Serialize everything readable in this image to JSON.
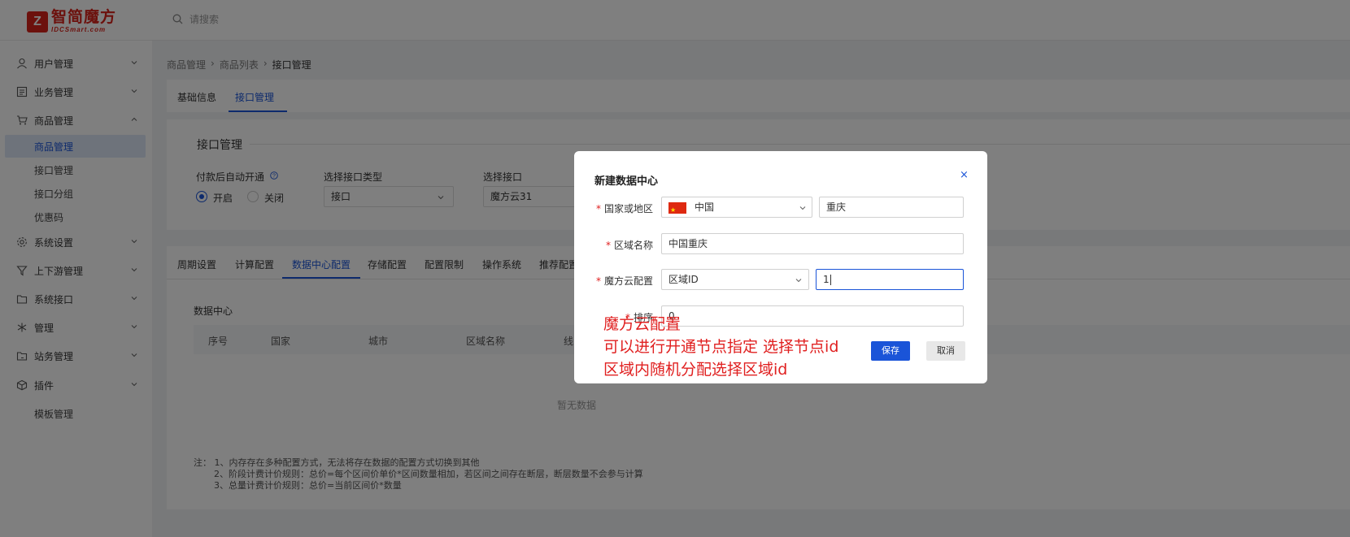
{
  "header": {
    "logo_cn": "智简魔方",
    "logo_en": "IDCSmart.com",
    "search_placeholder": "请搜索"
  },
  "sidebar": {
    "items": [
      {
        "label": "用户管理",
        "icon": "user-icon"
      },
      {
        "label": "业务管理",
        "icon": "list-icon"
      },
      {
        "label": "商品管理",
        "icon": "cart-icon",
        "expanded": true
      },
      {
        "label": "系统设置",
        "icon": "gear-icon"
      },
      {
        "label": "上下游管理",
        "icon": "filter-icon"
      },
      {
        "label": "系统接口",
        "icon": "folder-icon"
      },
      {
        "label": "管理",
        "icon": "asterisk-icon"
      },
      {
        "label": "站务管理",
        "icon": "folder-edit-icon"
      },
      {
        "label": "插件",
        "icon": "box-icon"
      }
    ],
    "subitems": [
      {
        "label": "商品管理",
        "active": true
      },
      {
        "label": "接口管理"
      },
      {
        "label": "接口分组"
      },
      {
        "label": "优惠码"
      }
    ],
    "template_item": "模板管理"
  },
  "breadcrumb": [
    "商品管理",
    "商品列表",
    "接口管理"
  ],
  "top_tabs": [
    "基础信息",
    "接口管理"
  ],
  "interface_section": {
    "title": "接口管理",
    "auto_open_label": "付款后自动开通",
    "radio_on": "开启",
    "radio_off": "关闭",
    "type_label": "选择接口类型",
    "type_value": "接口",
    "iface_label": "选择接口",
    "iface_value": "魔方云31"
  },
  "config_tabs": [
    "周期设置",
    "计算配置",
    "数据中心配置",
    "存储配置",
    "配置限制",
    "操作系统",
    "推荐配置"
  ],
  "datacenter": {
    "title": "数据中心",
    "columns": [
      "序号",
      "国家",
      "城市",
      "区域名称",
      "线"
    ],
    "empty": "暂无数据"
  },
  "notes": [
    "注：  1、内存存在多种配置方式，无法将存在数据的配置方式切换到其他",
    "2、阶段计费计价规则：总价=每个区间价单价*区间数量相加，若区间之间存在断层，断层数量不会参与计算",
    "3、总量计费计价规则：总价=当前区间价*数量"
  ],
  "dialog": {
    "title": "新建数据中心",
    "close": "×",
    "country_label": "国家或地区",
    "country_value": "中国",
    "city_value": "重庆",
    "area_label": "区域名称",
    "area_value": "中国重庆",
    "cloud_label": "魔方云配置",
    "cloud_type": "区域ID",
    "cloud_id": "1",
    "sort_label": "排序",
    "sort_value": "0",
    "save": "保存",
    "cancel": "取消"
  },
  "annotation": [
    "魔方云配置",
    "可以进行开通节点指定 选择节点id",
    "区域内随机分配选择区域id"
  ],
  "colors": {
    "primary": "#1a54d8",
    "brand": "#d9231a",
    "annotation": "#e02020"
  }
}
